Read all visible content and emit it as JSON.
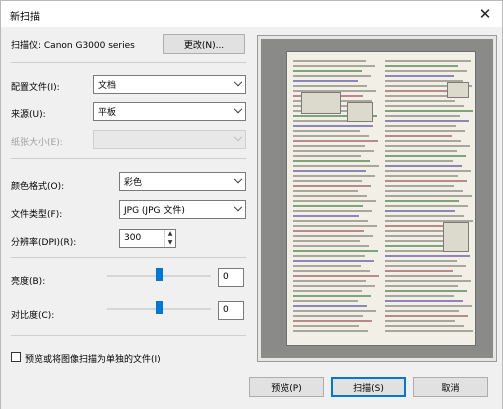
{
  "window": {
    "title": "新扫描",
    "close_glyph": "✕"
  },
  "scanner": {
    "label": "扫描仪: Canon G3000 series",
    "change_button": "更改(N)..."
  },
  "settings": {
    "profile": {
      "label": "配置文件(I):",
      "value": "文档"
    },
    "source": {
      "label": "来源(U):",
      "value": "平板"
    },
    "paper_size": {
      "label": "纸张大小(E):",
      "value": ""
    },
    "color_format": {
      "label": "颜色格式(O):",
      "value": "彩色"
    },
    "file_type": {
      "label": "文件类型(F):",
      "value": "JPG (JPG 文件)"
    },
    "resolution": {
      "label": "分辨率(DPI)(R):",
      "value": "300"
    },
    "brightness": {
      "label": "亮度(B):",
      "value": "0",
      "level": 0.5
    },
    "contrast": {
      "label": "对比度(C):",
      "value": "0",
      "level": 0.5
    }
  },
  "preview_separate": {
    "label": "预览或将图像扫描为单独的文件(I)",
    "checked": false
  },
  "buttons": {
    "preview": "预览(P)",
    "scan": "扫描(S)",
    "cancel": "取消"
  },
  "colors": {
    "accent": "#0078d7",
    "panel_bg": "#f0f0f0"
  }
}
